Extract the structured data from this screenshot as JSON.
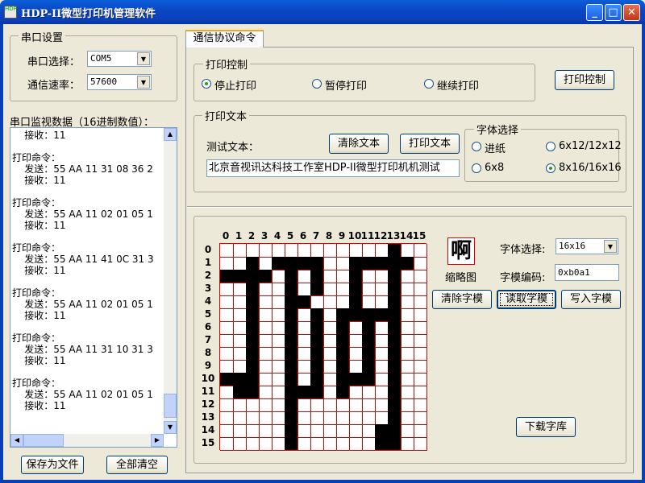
{
  "window": {
    "title": "HDP-II微型打印机管理软件",
    "icon_name": "app-icon"
  },
  "serial": {
    "group_title": "串口设置",
    "port_label": "串口选择：",
    "port_value": "COM5",
    "baud_label": "通信速率：",
    "baud_value": "57600"
  },
  "monitor": {
    "title": "串口监视数据（16进制数值）：",
    "lines": [
      "    接收：11",
      "",
      "打印命令：",
      "    发送：55 AA 11 31 08 36 2",
      "    接收：11",
      "",
      "打印命令：",
      "    发送：55 AA 11 02 01 05 1",
      "    接收：11",
      "",
      "打印命令：",
      "    发送：55 AA 11 41 0C 31 3",
      "    接收：11",
      "",
      "打印命令：",
      "    发送：55 AA 11 02 01 05 1",
      "    接收：11",
      "",
      "打印命令：",
      "    发送：55 AA 11 31 10 31 3",
      "    接收：11",
      "",
      "打印命令：",
      "    发送：55 AA 11 02 01 05 1",
      "    接收：11"
    ]
  },
  "buttons": {
    "save": "保存为文件",
    "clear_all": "全部清空"
  },
  "tab": {
    "label": "通信协议命令"
  },
  "print_control": {
    "group_title": "打印控制",
    "options": [
      "停止打印",
      "暂停打印",
      "继续打印"
    ],
    "selected": 0,
    "button": "打印控制"
  },
  "print_text": {
    "group_title": "打印文本",
    "label": "测试文本：",
    "clear_button": "清除文本",
    "print_button": "打印文本",
    "value": "北京音视讯达科技工作室HDP-II微型打印机机测试"
  },
  "font_select": {
    "group_title": "字体选择",
    "options": [
      "进纸",
      "6x12/12x12",
      "6x8",
      "8x16/16x16"
    ],
    "selected": 3
  },
  "glyph": {
    "col_headers": [
      "0",
      "1",
      "2",
      "3",
      "4",
      "5",
      "6",
      "7",
      "8",
      "9",
      "10",
      "11",
      "12",
      "13",
      "14",
      "15"
    ],
    "row_headers": [
      "0",
      "1",
      "2",
      "3",
      "4",
      "5",
      "6",
      "7",
      "8",
      "9",
      "10",
      "11",
      "12",
      "13",
      "14",
      "15"
    ],
    "rows": [
      "0000000000000100",
      "0010111100111110",
      "1111010100100100",
      "0010010100100100",
      "0010011000100100",
      "0010010101111100",
      "0010010101010100",
      "0010010101010100",
      "0010010101010100",
      "0010010101010100",
      "1110010101110100",
      "0110011101000100",
      "0000010000000100",
      "0000010000000100",
      "0000010000001100",
      "0000010000001100"
    ],
    "thumbnail_char": "啊",
    "thumbnail_label": "缩略图",
    "font_label": "字体选择:",
    "font_value": "16x16",
    "code_label": "字模编码:",
    "code_value": "0xb0a1",
    "clear_button": "清除字模",
    "read_button": "读取字模",
    "write_button": "写入字模",
    "download_button": "下载字库"
  },
  "colors": {
    "titlebar": "#0a48c8",
    "face": "#ece9d8",
    "grid_line": "#dd0000",
    "pixel_on": "#000000"
  }
}
